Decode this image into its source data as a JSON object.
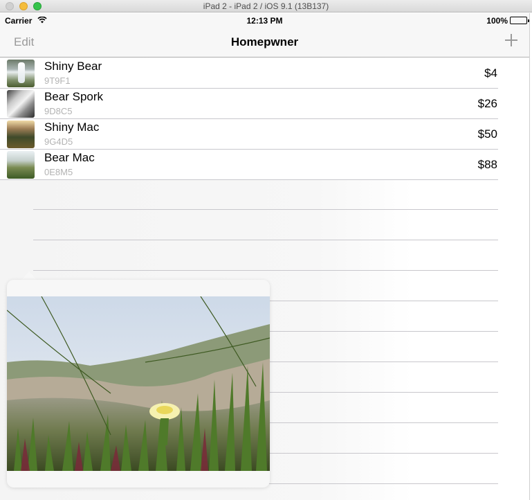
{
  "window": {
    "title": "iPad 2 - iPad 2 / iOS 9.1 (13B137)"
  },
  "status_bar": {
    "carrier": "Carrier",
    "time": "12:13 PM",
    "battery": "100%"
  },
  "nav": {
    "edit_label": "Edit",
    "title": "Homepwner",
    "add_icon": "plus-icon"
  },
  "items": [
    {
      "name": "Shiny Bear",
      "serial": "9T9F1",
      "value": "$4"
    },
    {
      "name": "Bear Spork",
      "serial": "9D8C5",
      "value": "$26"
    },
    {
      "name": "Shiny Mac",
      "serial": "9G4D5",
      "value": "$50"
    },
    {
      "name": "Bear Mac",
      "serial": "0E8M5",
      "value": "$88"
    }
  ],
  "popover": {
    "image_icon": "flower-photo"
  },
  "colors": {
    "nav_button": "#9a9a9a",
    "separator": "#c8c7cc",
    "serial_text": "#b3b3b3"
  }
}
